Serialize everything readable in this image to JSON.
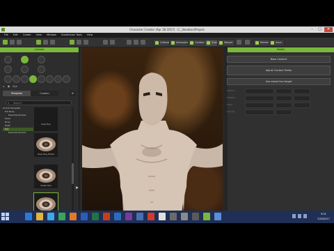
{
  "window": {
    "title": "Character Creator (Apr 28 2017) - C:_Skeleton/Project",
    "buttons": {
      "minimize": "–",
      "maximize": "□",
      "close": "✕"
    }
  },
  "menu": [
    "File",
    "Edit",
    "Create",
    "View",
    "Window",
    "Subdivision Tools",
    "Help"
  ],
  "toolbar": {
    "buttons": [
      {
        "label": "Calibrate",
        "icon": "calibrate-icon"
      },
      {
        "label": "Atmosphere",
        "icon": "atmosphere-icon"
      },
      {
        "label": "Conform",
        "icon": "conform-icon"
      },
      {
        "label": "Scale",
        "icon": "scale-icon",
        "active": true
      },
      {
        "label": "Weight",
        "icon": "weight-icon"
      },
      {
        "label": "Refresh",
        "icon": "refresh-icon"
      },
      {
        "label": "Save",
        "icon": "save-icon"
      }
    ]
  },
  "left_panel": {
    "header": "Content",
    "path": "Eye",
    "tabs": [
      "Template",
      "Custom"
    ],
    "search_placeholder": "Search",
    "tree": [
      {
        "label": "Actorbl Template",
        "selected": false
      },
      {
        "label": "Full Body",
        "selected": false
      },
      {
        "label": "Essential Morphs",
        "selected": false
      },
      {
        "label": "Head",
        "selected": false
      },
      {
        "label": "Body",
        "selected": false
      },
      {
        "label": "Teeth",
        "selected": false
      },
      {
        "label": "Eye",
        "selected": true
      },
      {
        "label": "Essential Morphs",
        "selected": false
      }
    ],
    "thumbnails": [
      {
        "label": "Grey Eye"
      },
      {
        "label": "Grey Eye_Sharp"
      },
      {
        "label": "Green Eye"
      },
      {
        "label": "Purple Eye"
      }
    ]
  },
  "right_panel": {
    "header": "Modify",
    "buttons": [
      "Base Content",
      "Adjust Contact Points",
      "Use adjust line target"
    ],
    "params": [
      "Position",
      "Rotation",
      "Scale",
      "Opacity"
    ]
  },
  "taskbar": {
    "time": "9:51",
    "date": "7/20/2017",
    "icons": [
      "ie-icon",
      "folder-icon",
      "store-icon",
      "chrome-icon",
      "firefox-icon",
      "word-icon",
      "excel-icon",
      "powerpoint-icon",
      "outlook-icon",
      "onenote-icon",
      "media-icon",
      "app-icon",
      "app-icon",
      "app-icon",
      "app-icon",
      "app-icon",
      "app-icon",
      "app-icon"
    ]
  },
  "colors": {
    "accent": "#7ab83b",
    "taskbar": "#1f2f55"
  }
}
